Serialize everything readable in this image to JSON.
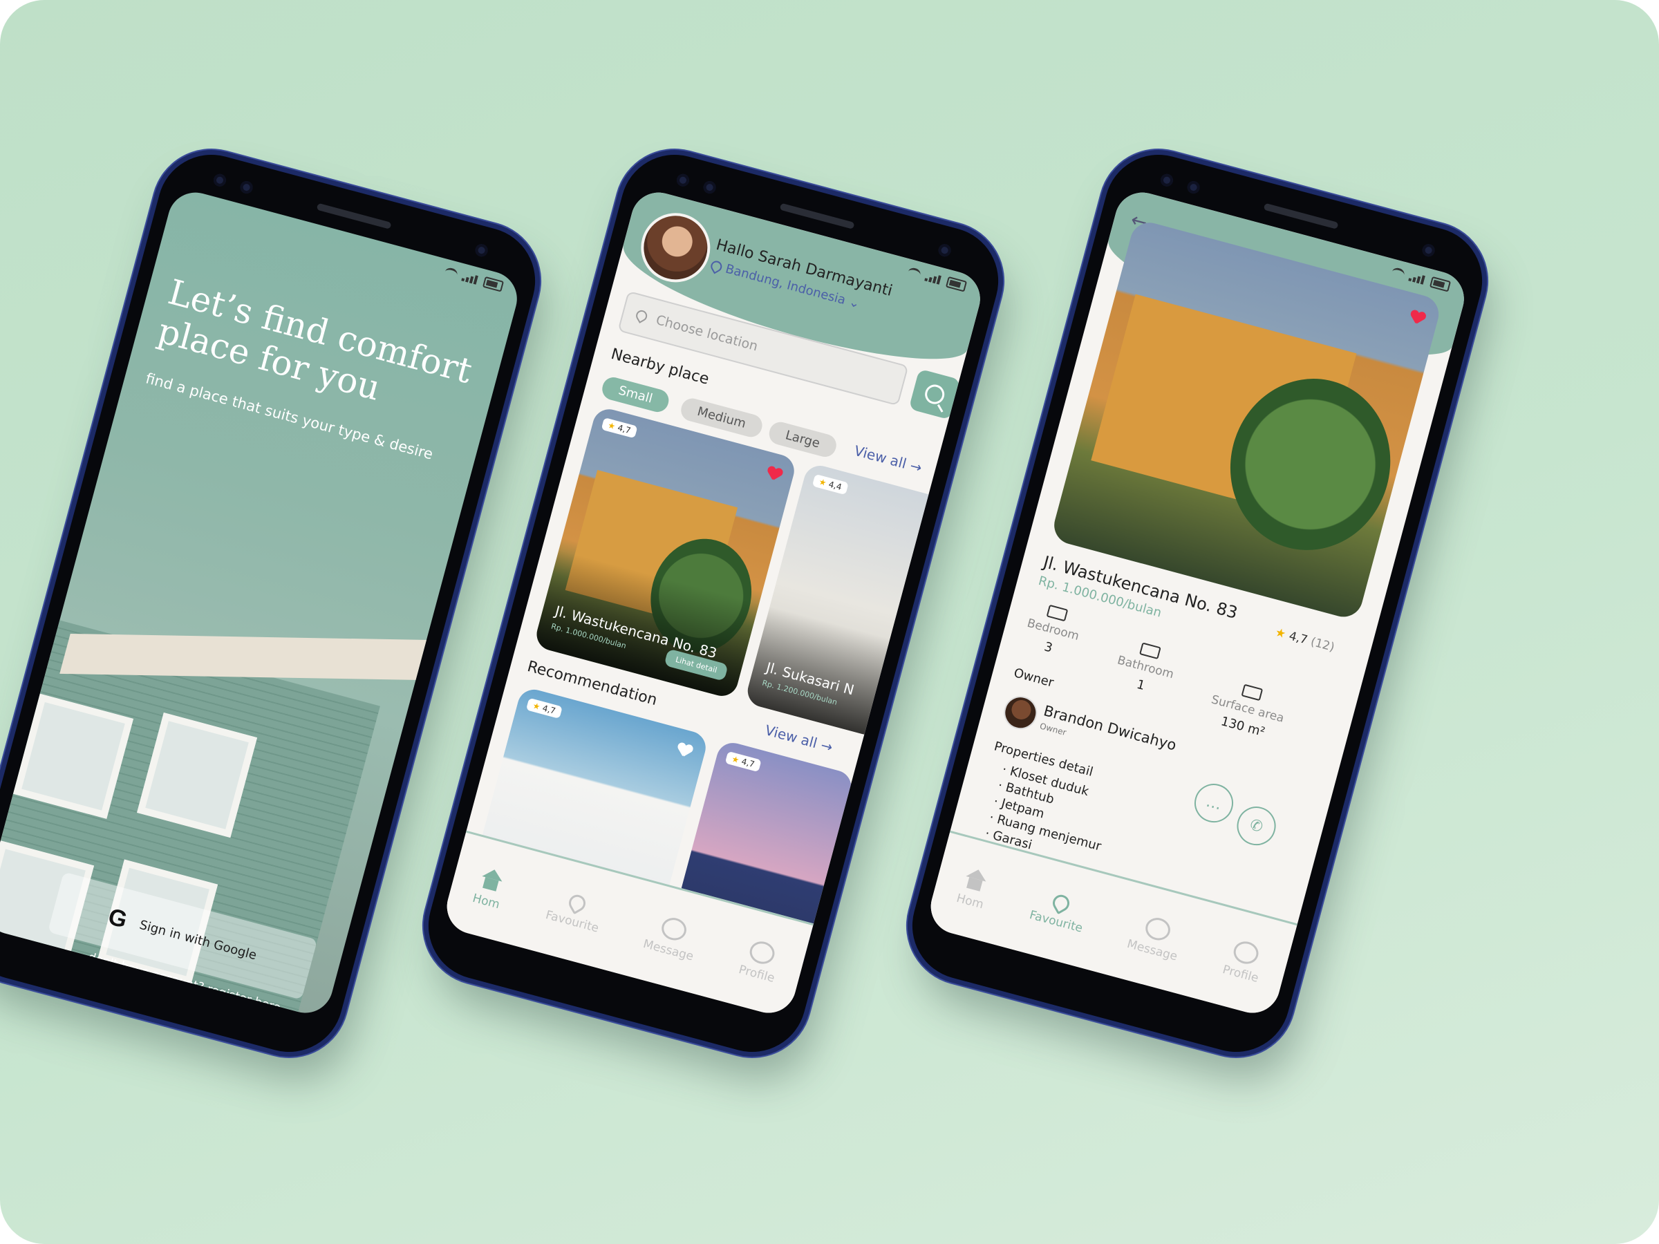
{
  "phone1": {
    "headline": "Let’s find comfort place for you",
    "subtitle": "find a place that suits your type & desire",
    "google_button": "Sign in with Google",
    "register_text": "don't have account? register here"
  },
  "phone2": {
    "greeting": "Hallo Sarah Darmayanti",
    "location": "Bandung, Indonesia",
    "search_placeholder": "Choose location",
    "nearby_title": "Nearby place",
    "chips": [
      "Small",
      "Medium",
      "Large"
    ],
    "view_all": "View all →",
    "cards": [
      {
        "rating": "4,7",
        "name": "Jl. Wastukencana No. 83",
        "price": "Rp. 1.000.000/bulan",
        "button": "Lihat detail"
      },
      {
        "rating": "4,4",
        "name": "Jl. Sukasari N",
        "price": "Rp. 1.200.000/bulan"
      }
    ],
    "recommendation_title": "Recommendation",
    "view_all_2": "View all →",
    "rec_ratings": [
      "4,7",
      "4,7"
    ],
    "tabs": [
      "Hom",
      "Favourite",
      "Message",
      "Profile"
    ]
  },
  "phone3": {
    "name": "Jl. Wastukencana No. 83",
    "price": "Rp. 1.000.000/bulan",
    "rating": "4,7",
    "rating_count": "(12)",
    "features": [
      {
        "label": "Bedroom",
        "value": "3"
      },
      {
        "label": "Bathroom",
        "value": "1"
      },
      {
        "label": "Surface area",
        "value": "130 m²"
      }
    ],
    "owner_label": "Owner",
    "owner_name": "Brandon Dwicahyo",
    "owner_role": "Owner",
    "properties_title": "Properties detail",
    "properties": [
      "Kloset duduk",
      "Bathtub",
      "Jetpam",
      "Ruang menjemur",
      "Garasi"
    ],
    "tabs": [
      "Hom",
      "Favourite",
      "Message",
      "Profile"
    ]
  },
  "colors": {
    "accent": "#7fb3a1",
    "header": "#89b5a6",
    "link": "#4b5fa8",
    "heart": "#f02a4a",
    "background": "#c4e3cc"
  },
  "icons": [
    "google-icon",
    "location-pin-icon",
    "search-icon",
    "star-icon",
    "heart-icon",
    "home-icon",
    "favourite-icon",
    "message-icon",
    "profile-icon",
    "back-arrow-icon",
    "bed-icon",
    "bathroom-icon",
    "house-icon",
    "chat-icon",
    "phone-icon"
  ]
}
